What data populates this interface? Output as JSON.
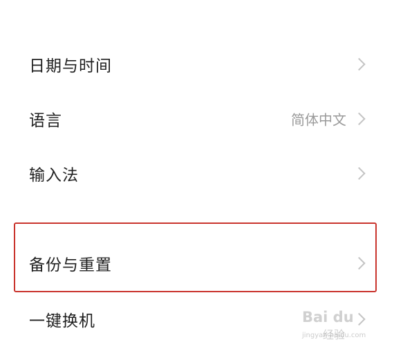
{
  "settings": {
    "items": [
      {
        "label": "日期与时间",
        "value": ""
      },
      {
        "label": "语言",
        "value": "简体中文"
      },
      {
        "label": "输入法",
        "value": ""
      },
      {
        "label": "备份与重置",
        "value": ""
      },
      {
        "label": "一键换机",
        "value": ""
      }
    ]
  },
  "icons": {
    "chevron": "chevron-right-icon"
  },
  "highlight": {
    "color": "#c9332c"
  },
  "watermark": {
    "logo": "Bai du",
    "sub": "经验",
    "url": "jingyan.baidu.com"
  }
}
